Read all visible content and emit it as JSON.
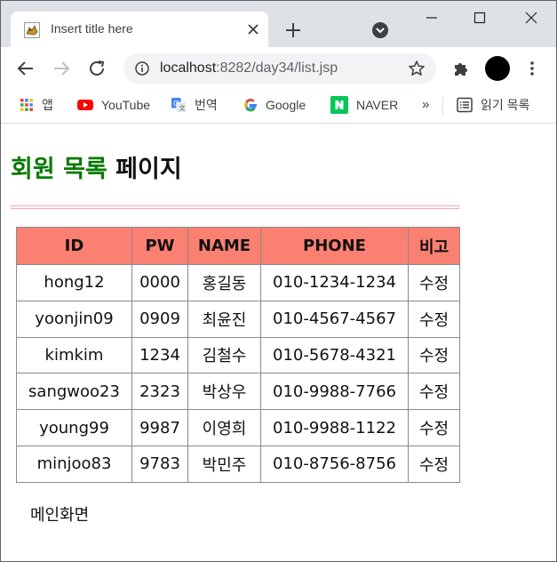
{
  "browser": {
    "tab_title": "Insert title here",
    "url_host": "localhost",
    "url_rest": ":8282/day34/list.jsp"
  },
  "bookmarks": {
    "items": [
      {
        "label": "앱",
        "icon": "apps-grid-icon"
      },
      {
        "label": "YouTube",
        "icon": "youtube-icon"
      },
      {
        "label": "번역",
        "icon": "translate-icon"
      },
      {
        "label": "Google",
        "icon": "google-icon"
      },
      {
        "label": "NAVER",
        "icon": "naver-icon"
      }
    ],
    "overflow": "»",
    "reading_list": "읽기 목록"
  },
  "page": {
    "title_green": "회원 목록",
    "title_black": "페이지",
    "table": {
      "headers": [
        "ID",
        "PW",
        "NAME",
        "PHONE",
        "비고"
      ],
      "rows": [
        {
          "id": "hong12",
          "pw": "0000",
          "name": "홍길동",
          "phone": "010-1234-1234",
          "note": "수정"
        },
        {
          "id": "yoonjin09",
          "pw": "0909",
          "name": "최윤진",
          "phone": "010-4567-4567",
          "note": "수정"
        },
        {
          "id": "kimkim",
          "pw": "1234",
          "name": "김철수",
          "phone": "010-5678-4321",
          "note": "수정"
        },
        {
          "id": "sangwoo23",
          "pw": "2323",
          "name": "박상우",
          "phone": "010-9988-7766",
          "note": "수정"
        },
        {
          "id": "young99",
          "pw": "9987",
          "name": "이영희",
          "phone": "010-9988-1122",
          "note": "수정"
        },
        {
          "id": "minjoo83",
          "pw": "9783",
          "name": "박민주",
          "phone": "010-8756-8756",
          "note": "수정"
        }
      ]
    },
    "main_link": "메인화면"
  },
  "colors": {
    "header_bg": "#fa8072",
    "title_green": "#067a00",
    "rule_pink": "#ff9fc0"
  }
}
